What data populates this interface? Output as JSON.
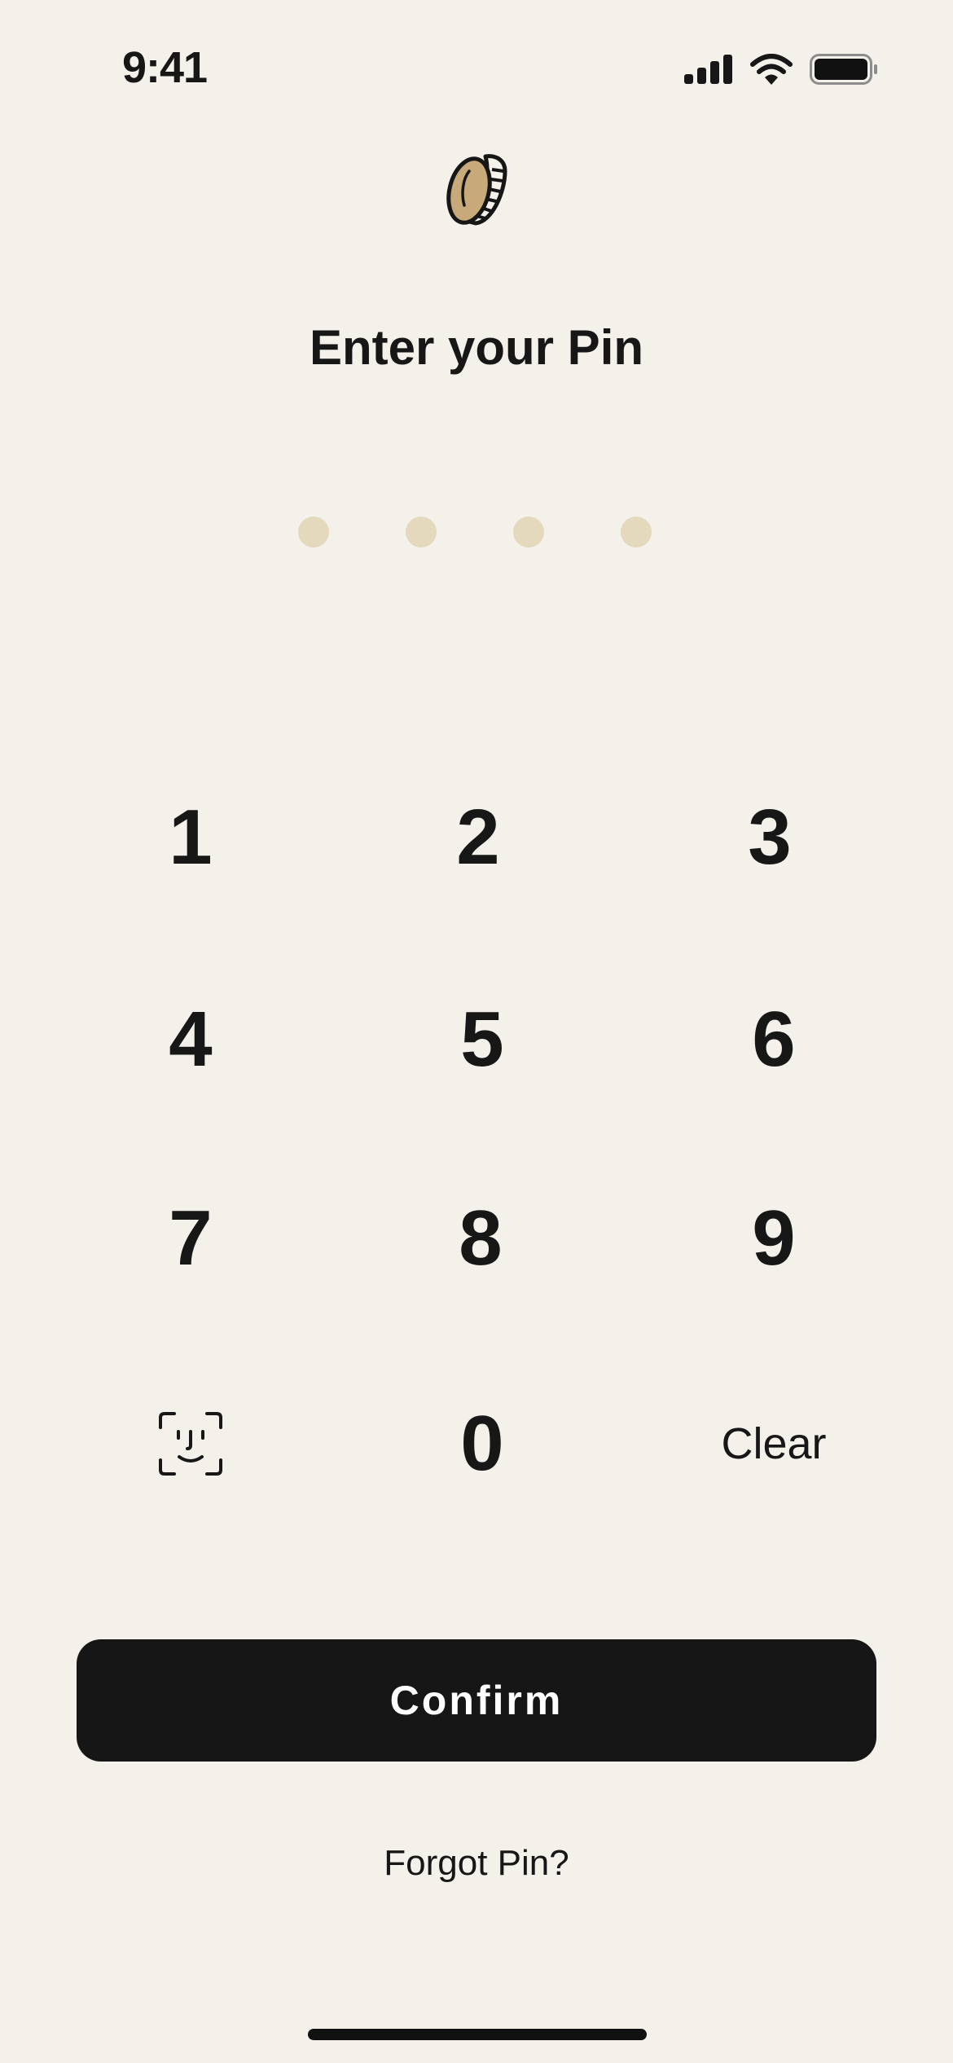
{
  "status_bar": {
    "time": "9:41",
    "icons": [
      "cellular-signal-icon",
      "wifi-icon",
      "battery-icon"
    ]
  },
  "logo": {
    "icon": "coin-icon",
    "color": "#c8a97a"
  },
  "title": "Enter your Pin",
  "pin": {
    "length": 4,
    "entered": 0,
    "dot_color": "#e4d8bd"
  },
  "keypad": {
    "digits": [
      "1",
      "2",
      "3",
      "4",
      "5",
      "6",
      "7",
      "8",
      "9",
      "0"
    ],
    "biometric_icon": "face-id-icon",
    "clear_label": "Clear"
  },
  "confirm_label": "Confirm",
  "forgot_label": "Forgot Pin?",
  "colors": {
    "background": "#f3f1ea",
    "text": "#171717",
    "button": "#161616",
    "button_text": "#ffffff"
  }
}
